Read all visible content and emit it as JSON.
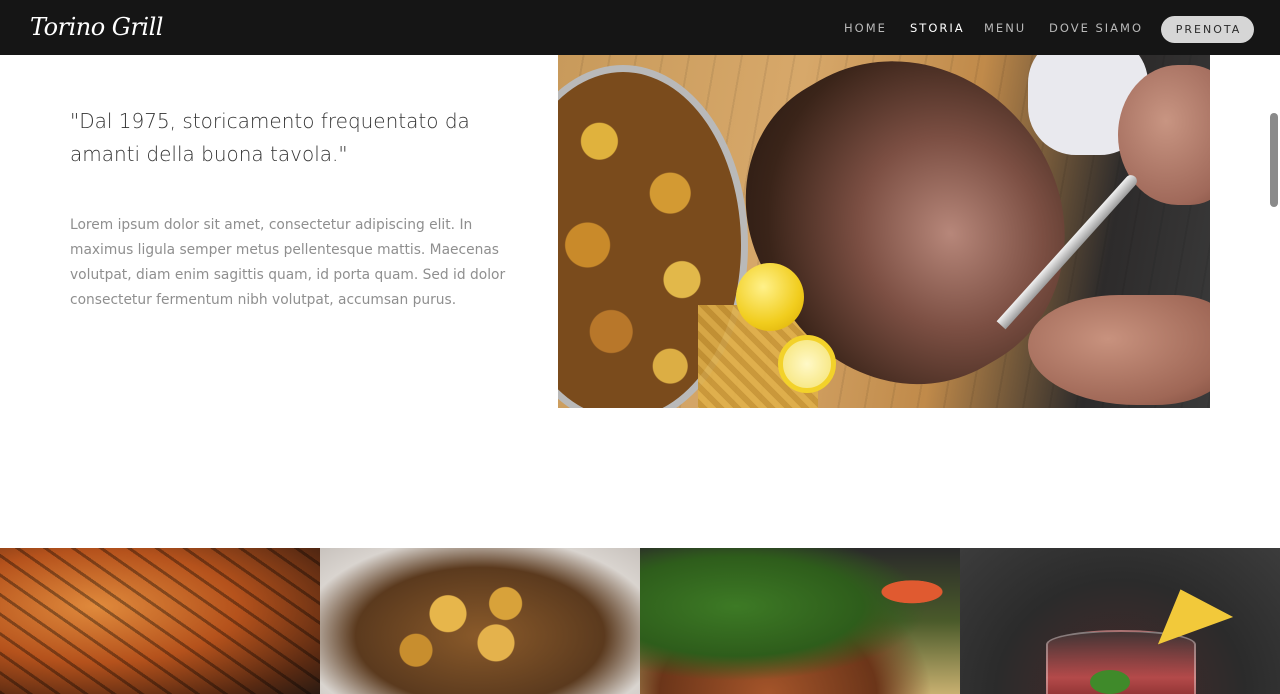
{
  "brand": {
    "logo_text": "Torino Grill"
  },
  "nav": {
    "home": "HOME",
    "storia": "STORIA",
    "menu": "MENU",
    "dove_siamo": "DOVE SIAMO",
    "prenota": "PRENOTA",
    "active_item": "STORIA"
  },
  "storia": {
    "quote": "\"Dal 1975, storicamento frequentato da amanti della buona tavola.\"",
    "body": "Lorem ipsum dolor sit amet, consectetur adipiscing elit. In maximus ligula semper metus pellentesque mattis. Maecenas volutpat, diam enim sagittis quam, id porta quam. Sed id dolor consectetur fermentum nibh volutpat, accumsan purus."
  },
  "colors": {
    "navbar_bg": "#151515",
    "nav_link": "#b9b9b9",
    "nav_active": "#ffffff",
    "button_bg": "#d6d6d6",
    "quote_text": "#333333",
    "body_text": "#8f8f8f"
  },
  "images": {
    "hero": "roast-meat-carving-board-photo",
    "gallery": [
      "grilled-chicken-photo",
      "roasted-potatoes-meat-photo",
      "salad-bowl-photo",
      "cocktail-pineapple-photo"
    ]
  }
}
